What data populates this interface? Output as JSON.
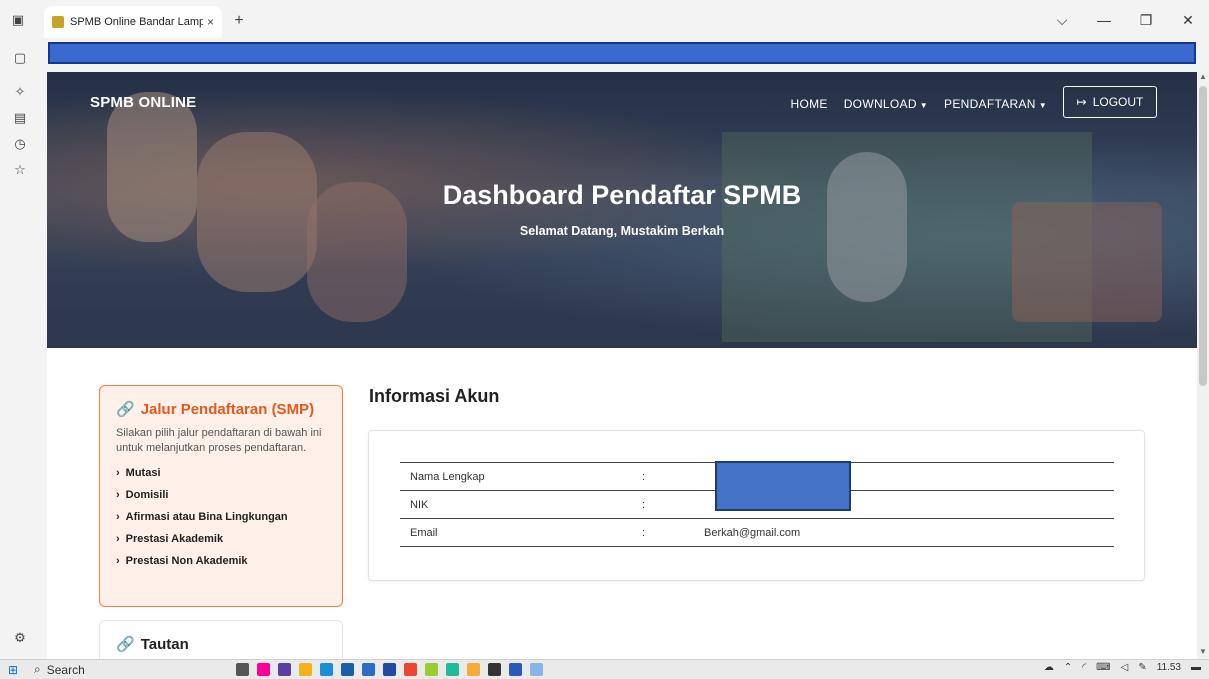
{
  "browser": {
    "tab_title": "SPMB Online Bandar Lampung",
    "tab_close": "×",
    "new_tab": "+",
    "controls": {
      "dropdown": "⌵",
      "minimize": "—",
      "restore": "❐",
      "close": "✕"
    }
  },
  "nav": {
    "brand": "SPMB ONLINE",
    "links": [
      {
        "label": "HOME",
        "has_caret": false
      },
      {
        "label": "DOWNLOAD",
        "has_caret": true
      },
      {
        "label": "PENDAFTARAN",
        "has_caret": true
      }
    ],
    "logout_label": "LOGOUT"
  },
  "hero": {
    "title": "Dashboard Pendaftar SPMB",
    "subtitle": "Selamat Datang, Mustakim Berkah"
  },
  "jalur": {
    "title": "Jalur Pendaftaran (SMP)",
    "description": "Silakan pilih jalur pendaftaran di bawah ini untuk melanjutkan proses pendaftaran.",
    "items": [
      "Mutasi",
      "Domisili",
      "Afirmasi atau Bina Lingkungan",
      "Prestasi Akademik",
      "Prestasi Non Akademik"
    ]
  },
  "tautan": {
    "title": "Tautan"
  },
  "informasi": {
    "heading": "Informasi Akun",
    "rows": [
      {
        "label": "Nama Lengkap",
        "sep": ":",
        "value": ""
      },
      {
        "label": "NIK",
        "sep": ":",
        "value": ""
      },
      {
        "label": "Email",
        "sep": ":",
        "value": "Berkah@gmail.com"
      }
    ]
  },
  "taskbar": {
    "search_label": "Search",
    "time": "11.53"
  },
  "colors": {
    "accent": "#e8581d",
    "card_bg": "#fff1ea",
    "redact": "#4472c4"
  }
}
